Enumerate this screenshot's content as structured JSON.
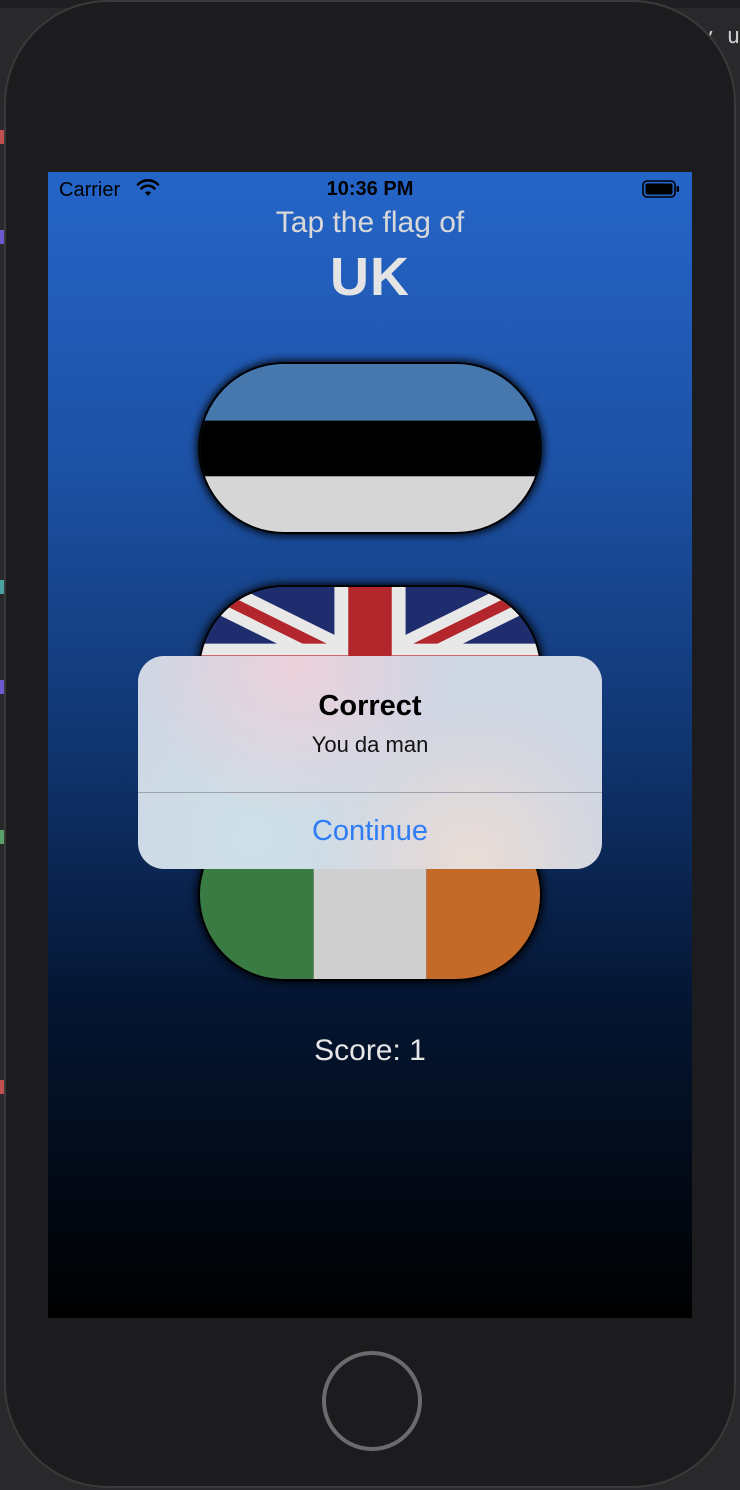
{
  "status_bar": {
    "carrier": "Carrier",
    "time": "10:36 PM"
  },
  "game": {
    "prompt": "Tap the flag of",
    "country": "UK",
    "score_label": "Score: 1",
    "flags": [
      {
        "name": "Estonia",
        "colors": [
          "#4677ad",
          "#000000",
          "#d6d6d6"
        ]
      },
      {
        "name": "UK",
        "colors": [
          "#1f2d6e",
          "#e8e8e8",
          "#b2262c"
        ]
      },
      {
        "name": "Ireland",
        "colors": [
          "#3a7b43",
          "#cfcfcf",
          "#c36a28"
        ]
      }
    ]
  },
  "alert": {
    "title": "Correct",
    "message": "You da man",
    "action": "Continue"
  },
  "ide": {
    "peek_text": "v u"
  },
  "colors": {
    "screen_top": "#2565c8",
    "screen_bottom": "#000000",
    "alert_action": "#2f7df6"
  }
}
